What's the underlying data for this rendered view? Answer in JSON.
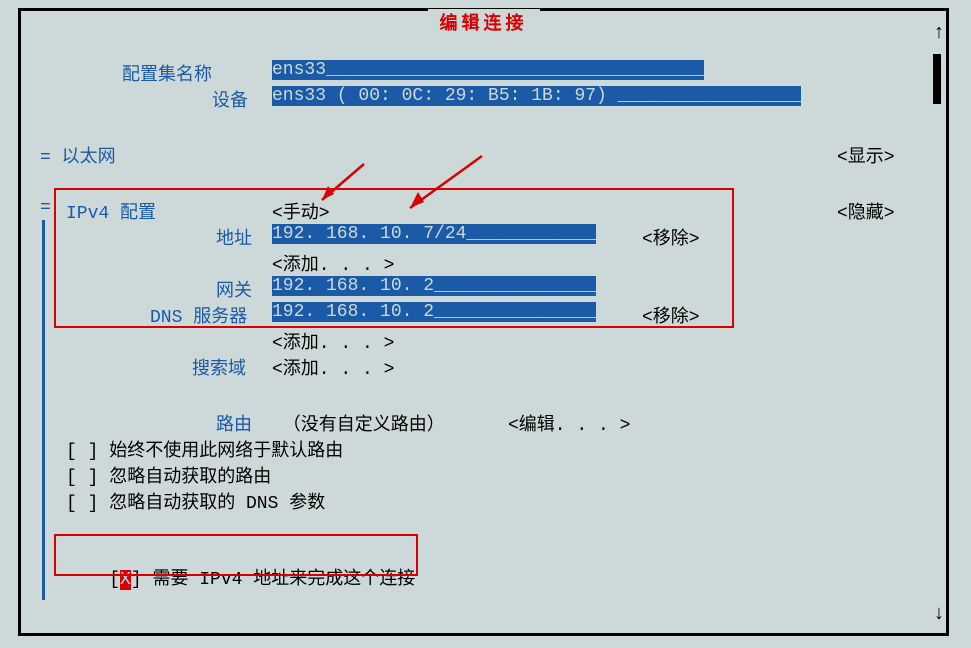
{
  "title": "编辑连接",
  "profile_name_label": "配置集名称",
  "profile_name_value": "ens33___________________________________",
  "device_label": "设备",
  "device_value": "ens33 ( 00: 0C: 29: B5: 1B: 97) _________________",
  "ethernet_label": "= 以太网",
  "show": "<显示>",
  "hide": "<隐藏>",
  "ipv4_label": "IPv4 配置",
  "ipv4_mode": "<手动>",
  "address_label": "地址",
  "address_val": "192. 168. 10. 7/24____________",
  "remove": "<移除>",
  "add": "<添加. . . >",
  "gateway_label": "网关",
  "gateway_val": "192. 168. 10. 2_______________",
  "dns_label": "DNS 服务器",
  "dns_val": "192. 168. 10. 2_______________",
  "search_label": "搜索域",
  "routes_label": "路由",
  "routes_msg": " （没有自定义路由）",
  "edit": "<编辑. . . >",
  "cb1": "[ ] 始终不使用此网络于默认路由",
  "cb2": "[ ] 忽略自动获取的路由",
  "cb3": "[ ] 忽略自动获取的 DNS 参数",
  "cb4_pre": "[",
  "cb4_x": "X",
  "cb4_post": "] 需要 IPv4 地址来完成这个连接",
  "equals": "="
}
